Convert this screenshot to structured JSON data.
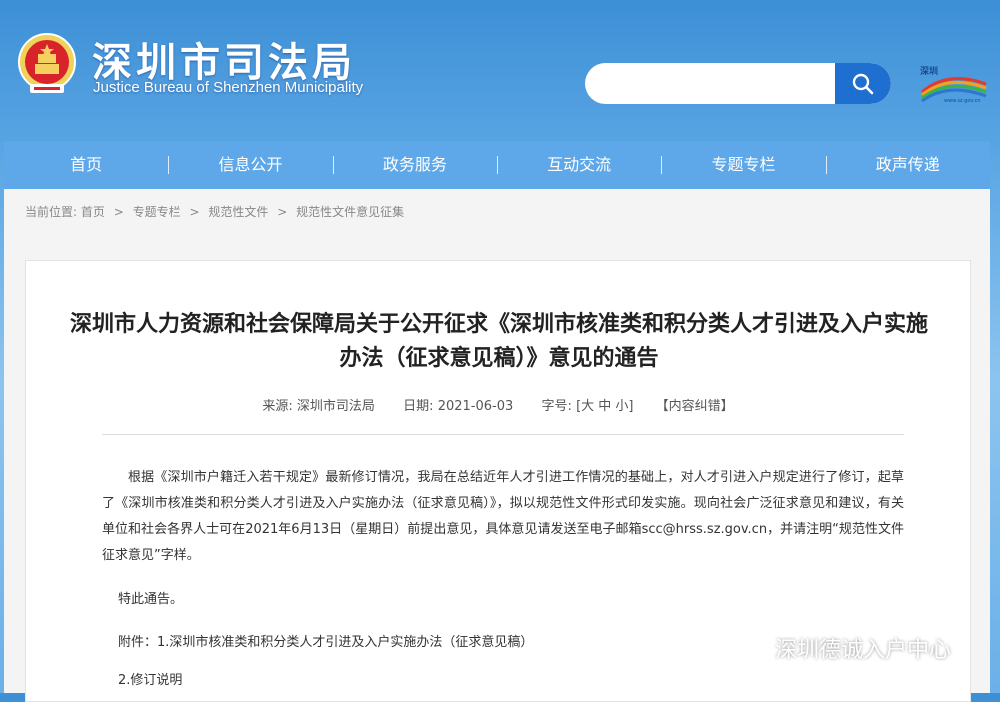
{
  "header": {
    "site_name_cn": "深圳市司法局",
    "site_name_en": "Justice Bureau of Shenzhen Municipality",
    "search_placeholder": "",
    "search_icon": "search-icon",
    "emblem_icon": "national-emblem-icon",
    "shenzhen_logo": {
      "name": "shenzhen-logo-icon",
      "text": "深圳",
      "small_text": "www.sz.gov.cn"
    }
  },
  "nav": {
    "items": [
      {
        "label": "首页"
      },
      {
        "label": "信息公开"
      },
      {
        "label": "政务服务"
      },
      {
        "label": "互动交流"
      },
      {
        "label": "专题专栏"
      },
      {
        "label": "政声传递"
      }
    ]
  },
  "breadcrumb": {
    "prefix": "当前位置:",
    "items": [
      "首页",
      "专题专栏",
      "规范性文件",
      "规范性文件意见征集"
    ],
    "separator": ">"
  },
  "article": {
    "title": "深圳市人力资源和社会保障局关于公开征求《深圳市核准类和积分类人才引进及入户实施办法（征求意见稿）》意见的通告",
    "meta": {
      "source_label": "来源:",
      "source_value": "深圳市司法局",
      "date_label": "日期:",
      "date_value": "2021-06-03",
      "font_label": "字号:",
      "font_controls": "[大 中 小]",
      "report_label": "【内容纠错】"
    },
    "paragraph": "根据《深圳市户籍迁入若干规定》最新修订情况，我局在总结近年人才引进工作情况的基础上，对人才引进入户规定进行了修订，起草了《深圳市核准类和积分类人才引进及入户实施办法（征求意见稿）》，拟以规范性文件形式印发实施。现向社会广泛征求意见和建议，有关单位和社会各界人士可在2021年6月13日（星期日）前提出意见，具体意见请发送至电子邮箱scc@hrss.sz.gov.cn，并请注明“规范性文件征求意见”字样。",
    "notice_end": "特此通告。",
    "attachment_1": "附件：1.深圳市核准类和积分类人才引进及入户实施办法（征求意见稿）",
    "attachment_2": "2.修订说明"
  },
  "watermark": {
    "icon": "wechat-icon",
    "text": "深圳德诚入户中心"
  },
  "colors": {
    "nav_bg": "#5ea8ea",
    "search_button": "#1f6fd0",
    "panel_bg": "#f4f4f4"
  }
}
